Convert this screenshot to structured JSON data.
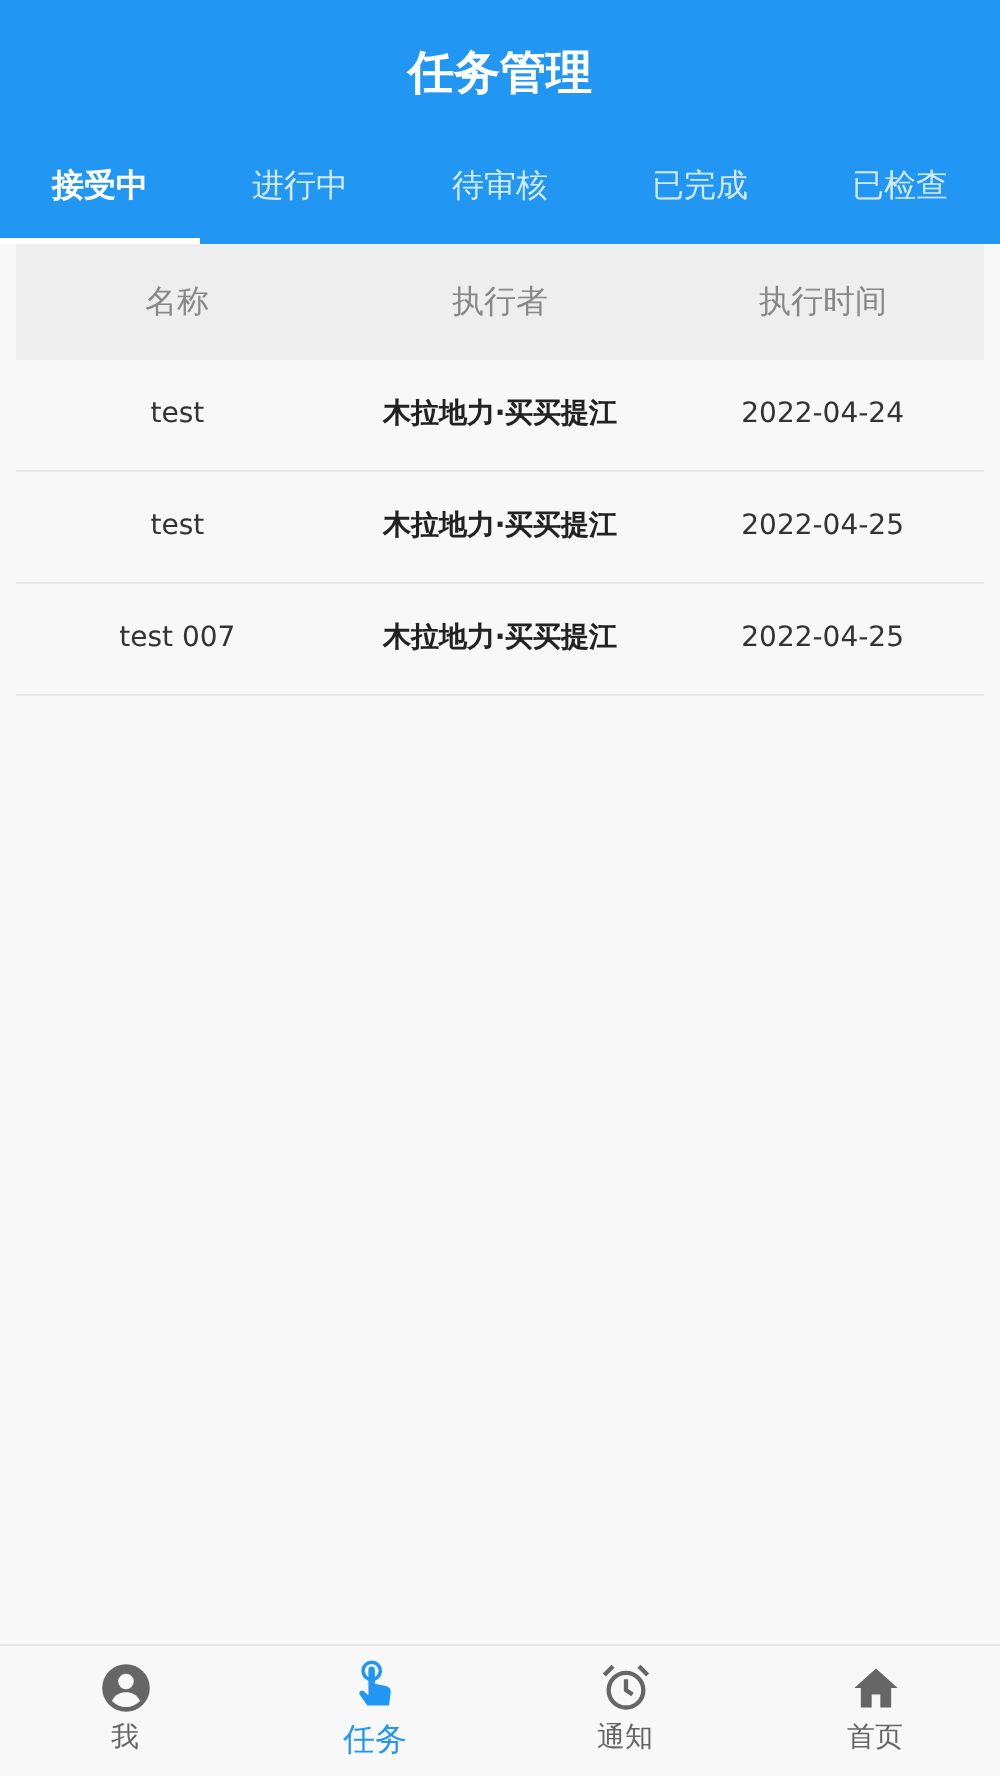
{
  "header": {
    "title": "任务管理"
  },
  "tabs": [
    {
      "label": "接受中",
      "selected": true
    },
    {
      "label": "进行中",
      "selected": false
    },
    {
      "label": "待审核",
      "selected": false
    },
    {
      "label": "已完成",
      "selected": false
    },
    {
      "label": "已检查",
      "selected": false
    }
  ],
  "table": {
    "columns": [
      "名称",
      "执行者",
      "执行时间"
    ],
    "rows": [
      [
        "test",
        "木拉地力·买买提江",
        "2022-04-24"
      ],
      [
        "test",
        "木拉地力·买买提江",
        "2022-04-25"
      ],
      [
        "test 007",
        "木拉地力·买买提江",
        "2022-04-25"
      ]
    ]
  },
  "bottom_nav": [
    {
      "kind": "person",
      "label": "我",
      "selected": false
    },
    {
      "kind": "task",
      "label": "任务",
      "selected": true
    },
    {
      "kind": "alarm",
      "label": "通知",
      "selected": false
    },
    {
      "kind": "home",
      "label": "首页",
      "selected": false
    }
  ]
}
